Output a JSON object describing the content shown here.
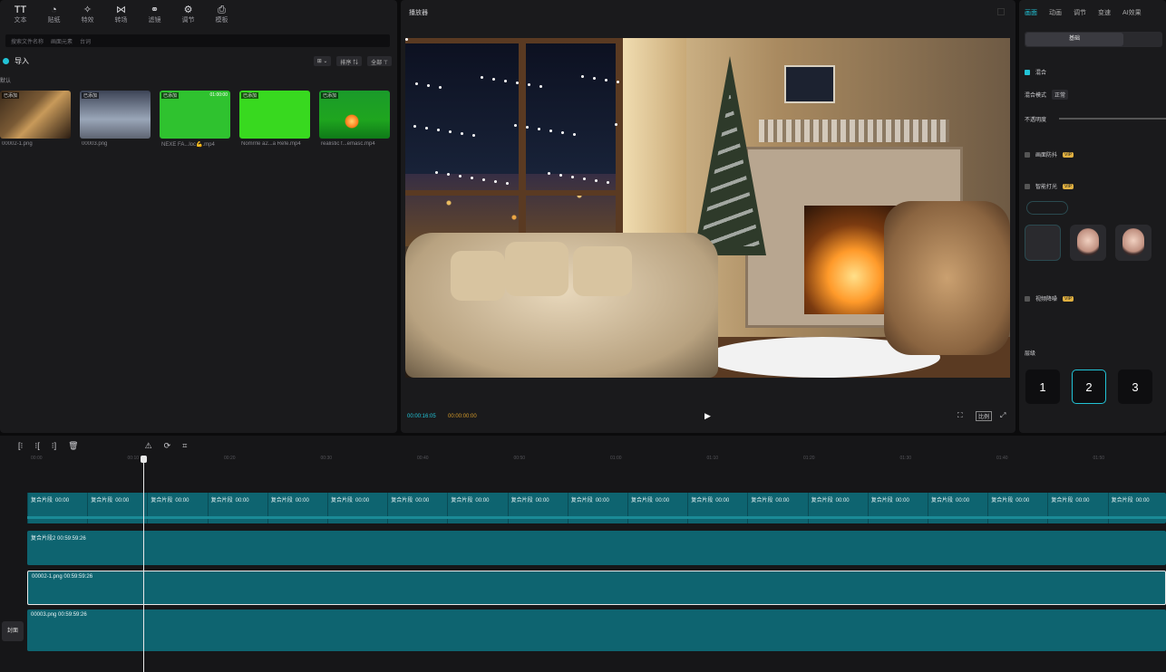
{
  "toolbar": {
    "tools": [
      {
        "icon": "text-icon",
        "glyph": "TT",
        "label": "文本"
      },
      {
        "icon": "sticker-icon",
        "glyph": "◔",
        "label": "贴纸"
      },
      {
        "icon": "effects-icon",
        "glyph": "✧",
        "label": "特效"
      },
      {
        "icon": "transition-icon",
        "glyph": "⋈",
        "label": "转场"
      },
      {
        "icon": "filter-icon",
        "glyph": "⚭",
        "label": "滤镜"
      },
      {
        "icon": "adjust-icon",
        "glyph": "⚙",
        "label": "调节"
      },
      {
        "icon": "template-icon",
        "glyph": "⎙",
        "label": "模板"
      }
    ]
  },
  "media": {
    "search_tabs": [
      "搜索文件名称",
      "画面元素",
      "台词"
    ],
    "import_label": "导入",
    "view_buttons": [
      "⊞ ⌄",
      "排序 ⇅",
      "全部 ⊤"
    ],
    "folder_label": "默认",
    "items": [
      {
        "name": "00002-1.png",
        "tag": "已添加",
        "duration": "",
        "style": "room"
      },
      {
        "name": "00003.png",
        "tag": "已添加",
        "duration": "",
        "style": "snow"
      },
      {
        "name": "NEXE FA...loc💪.mp4",
        "tag": "已添加",
        "duration": "01:00:00",
        "style": "green"
      },
      {
        "name": "Nomrrle a2...a Refe.mp4",
        "tag": "已添加",
        "duration": "",
        "style": "green2"
      },
      {
        "name": "realistic f...emasc.mp4",
        "tag": "已添加",
        "duration": "",
        "style": "fire"
      }
    ]
  },
  "preview": {
    "title": "播放器",
    "timecode_current": "00:00:16:05",
    "timecode_total": "00:00:00:00",
    "controls": [
      "⛶",
      "比例",
      "⤢"
    ]
  },
  "inspector": {
    "tabs": [
      "画面",
      "动画",
      "调节",
      "变速",
      "AI效果"
    ],
    "active_tab": 0,
    "segment_label": "基础",
    "blend_label": "混合",
    "blend_mode_label": "混合模式",
    "blend_mode_value": "正常",
    "opacity_label": "不透明度",
    "opacity": 1.0,
    "option1": "画面防抖",
    "option2": "智能打光",
    "option3": "视频降噪",
    "vip": "VIP",
    "layer_label": "层级",
    "layers": [
      "1",
      "2",
      "3"
    ],
    "selected_layer": "2"
  },
  "timeline": {
    "tools": [
      "[⁝",
      "⁝[",
      "⁝]",
      "🗑",
      "⚠",
      "⟳",
      "⌗"
    ],
    "ruler": [
      "00:00",
      "00:10",
      "00:20",
      "00:30",
      "00:40",
      "00:50",
      "01:00",
      "01:10",
      "01:20",
      "01:30",
      "01:40",
      "01:50"
    ],
    "compound_label": "复合片段",
    "compound_seg_time": "00:00",
    "track2_label": "复合片段2  00:59:59:26",
    "track3_label": "00002-1.png  00:59:59:26",
    "track4_label": "00003.png  00:59:59:26",
    "cover_label": "封面"
  }
}
